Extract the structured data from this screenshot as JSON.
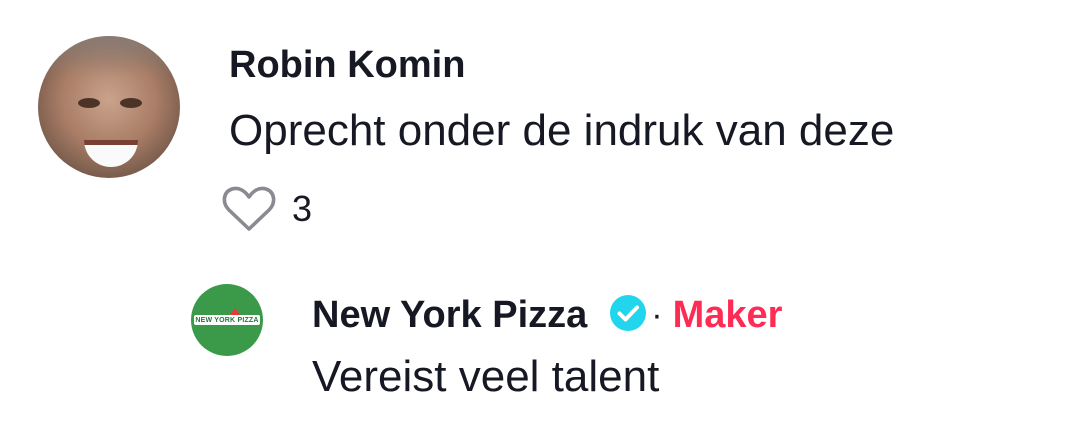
{
  "comment": {
    "username": "Robin Komin",
    "text": "Oprecht onder de indruk van deze",
    "likes": "3",
    "avatar": "user-photo-avatar",
    "like_icon": "heart-outline-icon"
  },
  "reply": {
    "username": "New York Pizza",
    "text": "Vereist veel talent",
    "separator": "·",
    "creator_badge": "Maker",
    "verified_icon": "verified-check-icon",
    "avatar_logo_text": "NEW YORK PIZZA"
  },
  "colors": {
    "text": "#161823",
    "creator_badge": "#fe2c55",
    "verified": "#20d5ec",
    "brand_green": "#3a9a4a"
  }
}
